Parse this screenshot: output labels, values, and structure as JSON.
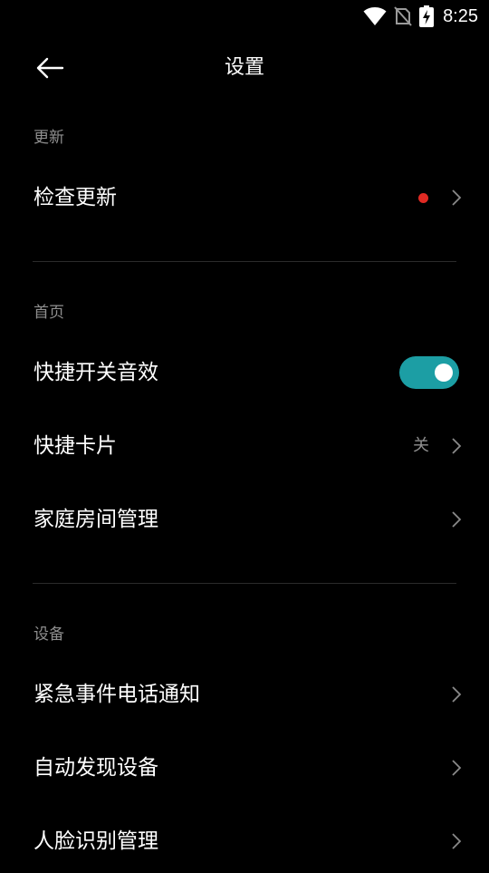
{
  "status_bar": {
    "time": "8:25",
    "icons": [
      "wifi-icon",
      "no-sim-icon",
      "battery-charging-icon"
    ]
  },
  "header": {
    "title": "设置",
    "back_icon": "back-arrow-icon"
  },
  "sections": {
    "update": {
      "header": "更新",
      "items": [
        {
          "label": "检查更新",
          "badge": "red-dot",
          "icon": "chevron-right-icon"
        }
      ]
    },
    "home": {
      "header": "首页",
      "items": [
        {
          "label": "快捷开关音效",
          "toggle_on": true,
          "icon": "toggle-switch"
        },
        {
          "label": "快捷卡片",
          "value": "关",
          "icon": "chevron-right-icon"
        },
        {
          "label": "家庭房间管理",
          "icon": "chevron-right-icon"
        }
      ]
    },
    "device": {
      "header": "设备",
      "items": [
        {
          "label": "紧急事件电话通知",
          "icon": "chevron-right-icon"
        },
        {
          "label": "自动发现设备",
          "icon": "chevron-right-icon"
        },
        {
          "label": "人脸识别管理",
          "icon": "chevron-right-icon"
        }
      ]
    }
  },
  "colors": {
    "background": "#000000",
    "accent": "#1c9ea4",
    "badge": "#e02a23",
    "secondary_text": "#8f8f8f",
    "divider": "#2b2b2b"
  }
}
